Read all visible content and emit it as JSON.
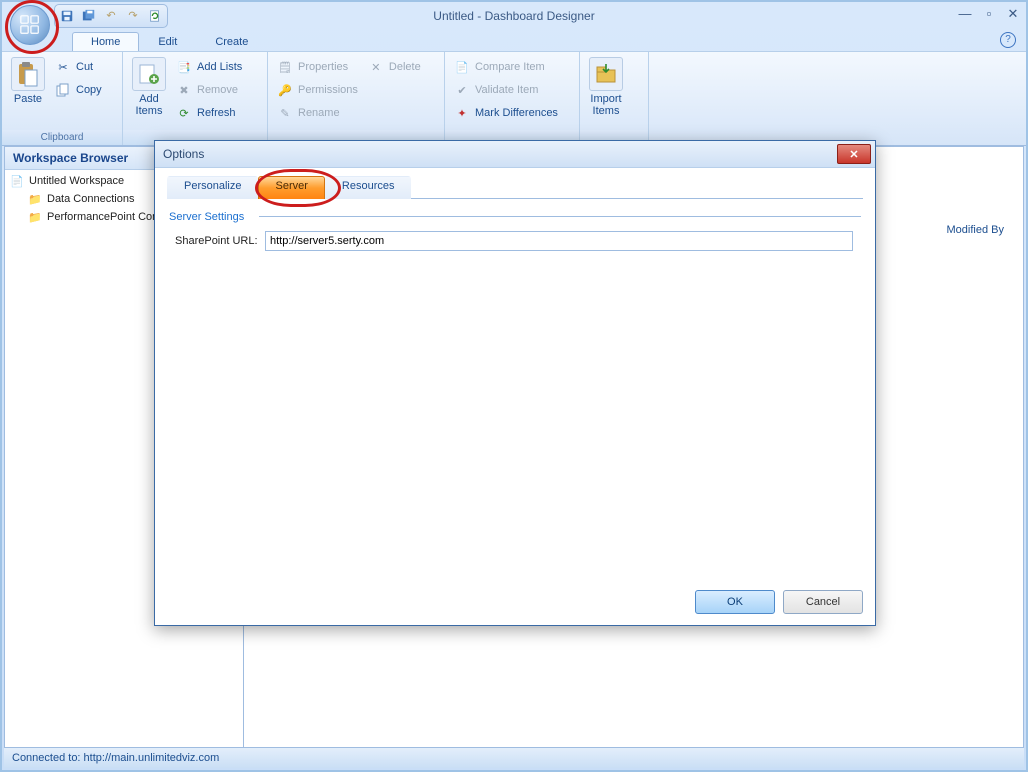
{
  "window": {
    "title": "Untitled  -  Dashboard Designer"
  },
  "tabs": {
    "home": "Home",
    "edit": "Edit",
    "create": "Create"
  },
  "ribbon": {
    "clipboard": {
      "label": "Clipboard",
      "paste": "Paste",
      "cut": "Cut",
      "copy": "Copy"
    },
    "add": {
      "add_items": "Add\nItems",
      "add_lists": "Add Lists",
      "remove": "Remove",
      "refresh": "Refresh"
    },
    "props": {
      "properties": "Properties",
      "delete": "Delete",
      "permissions": "Permissions",
      "rename": "Rename"
    },
    "compare": {
      "compare": "Compare Item",
      "validate": "Validate Item",
      "mark": "Mark Differences"
    },
    "import": {
      "label": "Import\nItems"
    }
  },
  "workspace": {
    "header": "Workspace Browser",
    "root": "Untitled Workspace",
    "items": [
      "Data Connections",
      "PerformancePoint Content"
    ]
  },
  "columns": {
    "modified_by": "Modified By"
  },
  "status": {
    "text": "Connected to: http://main.unlimitedviz.com"
  },
  "dialog": {
    "title": "Options",
    "tabs": {
      "personalize": "Personalize",
      "server": "Server",
      "resources": "Resources"
    },
    "section": "Server Settings",
    "url_label": "SharePoint URL:",
    "url_value": "http://server5.serty.com",
    "ok": "OK",
    "cancel": "Cancel"
  }
}
